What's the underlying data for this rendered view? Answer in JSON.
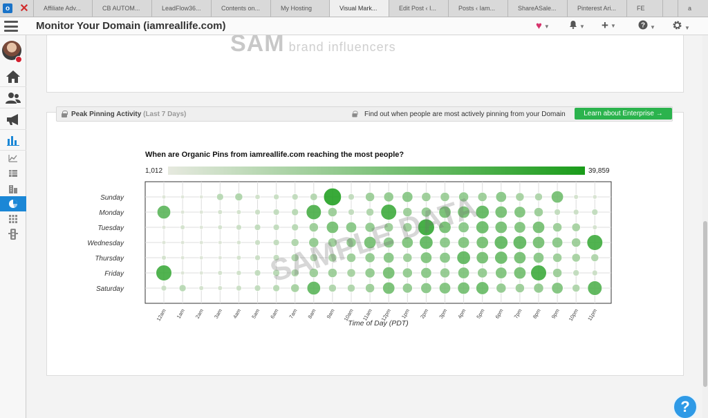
{
  "browser": {
    "tabs": [
      "Affiliate Adv...",
      "CB AUTOM...",
      "LeadFlow36...",
      "Contents on...",
      "My Hosting",
      "Visual Mark...",
      "Edit Post ‹ I...",
      "Posts ‹ Iam...",
      "ShareASale...",
      "Pinterest Ari...",
      "FE",
      "",
      "a"
    ],
    "active_tab_index": 5
  },
  "header": {
    "title": "Monitor Your Domain (iamreallife.com)",
    "icons": [
      "heart-icon",
      "bell-icon",
      "plus-icon",
      "help-circle-icon",
      "gear-icon"
    ]
  },
  "sidebar": {
    "items": [
      "home-icon",
      "users-icon",
      "megaphone-icon",
      "bar-chart-icon",
      "line-chart-icon",
      "table-icon",
      "buildings-icon",
      "pie-chart-icon",
      "grid-icon",
      "traffic-light-icon"
    ],
    "active_item": "pie-chart-icon"
  },
  "top_panel": {
    "watermark": "SAM",
    "logo_text": "brand influencers"
  },
  "section": {
    "title": "Peak Pinning Activity",
    "subtitle": "(Last 7 Days)",
    "promo_text": "Find out when people are most actively pinning from your Domain",
    "button_label": "Learn about Enterprise →"
  },
  "chart_data": {
    "type": "scatter",
    "title": "When are Organic Pins from iamreallife.com reaching the most people?",
    "xlabel": "Time of Day (PDT)",
    "ylabel": "",
    "legend": {
      "min_label": "1,012",
      "max_label": "39,859",
      "min_color": "#e6e9df",
      "max_color": "#1a9c1a"
    },
    "watermark": "SAMPLE DATA",
    "categories_x": [
      "12am",
      "1am",
      "2am",
      "3am",
      "4am",
      "5am",
      "6am",
      "7am",
      "8am",
      "9am",
      "10am",
      "11am",
      "12pm",
      "1pm",
      "2pm",
      "3pm",
      "4pm",
      "5pm",
      "6pm",
      "7pm",
      "8pm",
      "9pm",
      "10pm",
      "11pm"
    ],
    "categories_y": [
      "Sunday",
      "Monday",
      "Tuesday",
      "Wednesday",
      "Thursday",
      "Friday",
      "Saturday"
    ],
    "series": [
      {
        "day": "Sunday",
        "values": [
          0.05,
          0.04,
          0.04,
          0.25,
          0.3,
          0.12,
          0.16,
          0.2,
          0.28,
          0.98,
          0.2,
          0.4,
          0.45,
          0.5,
          0.4,
          0.4,
          0.45,
          0.4,
          0.5,
          0.35,
          0.3,
          0.6,
          0.1,
          0.08
        ]
      },
      {
        "day": "Monday",
        "values": [
          0.7,
          0.05,
          0.05,
          0.1,
          0.1,
          0.15,
          0.2,
          0.25,
          0.8,
          0.4,
          0.2,
          0.3,
          0.85,
          0.4,
          0.45,
          0.6,
          0.6,
          0.7,
          0.6,
          0.55,
          0.4,
          0.2,
          0.15,
          0.2
        ]
      },
      {
        "day": "Tuesday",
        "values": [
          0.05,
          0.1,
          0.05,
          0.1,
          0.15,
          0.2,
          0.2,
          0.25,
          0.4,
          0.6,
          0.5,
          0.45,
          0.4,
          0.4,
          0.9,
          0.6,
          0.5,
          0.65,
          0.6,
          0.55,
          0.6,
          0.4,
          0.35,
          0.1
        ]
      },
      {
        "day": "Wednesday",
        "values": [
          0.05,
          0.05,
          0.05,
          0.05,
          0.08,
          0.15,
          0.2,
          0.3,
          0.45,
          0.4,
          0.45,
          0.6,
          0.5,
          0.55,
          0.7,
          0.5,
          0.55,
          0.6,
          0.7,
          0.7,
          0.6,
          0.5,
          0.4,
          0.85
        ]
      },
      {
        "day": "Thursday",
        "values": [
          0.1,
          0.05,
          0.05,
          0.05,
          0.1,
          0.15,
          0.2,
          0.3,
          0.3,
          0.35,
          0.4,
          0.45,
          0.5,
          0.4,
          0.55,
          0.5,
          0.7,
          0.6,
          0.65,
          0.6,
          0.5,
          0.4,
          0.35,
          0.3
        ]
      },
      {
        "day": "Friday",
        "values": [
          0.85,
          0.05,
          0.05,
          0.1,
          0.12,
          0.2,
          0.25,
          0.3,
          0.4,
          0.4,
          0.35,
          0.45,
          0.6,
          0.45,
          0.5,
          0.45,
          0.55,
          0.45,
          0.55,
          0.6,
          0.85,
          0.4,
          0.2,
          0.15
        ]
      },
      {
        "day": "Saturday",
        "values": [
          0.15,
          0.25,
          0.1,
          0.1,
          0.15,
          0.2,
          0.25,
          0.35,
          0.7,
          0.3,
          0.3,
          0.4,
          0.6,
          0.45,
          0.5,
          0.55,
          0.6,
          0.65,
          0.45,
          0.4,
          0.45,
          0.55,
          0.3,
          0.75
        ]
      }
    ]
  }
}
